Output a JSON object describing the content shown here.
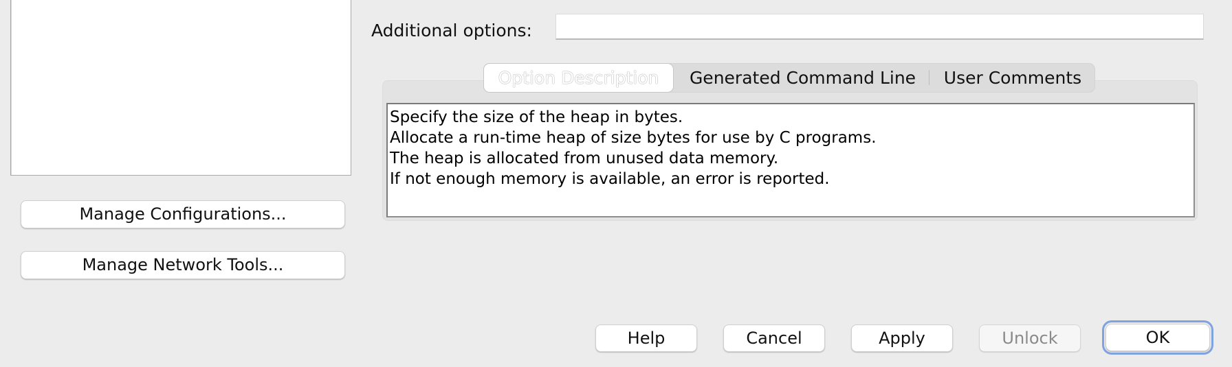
{
  "left_panel": {
    "manage_configurations_label": "Manage Configurations...",
    "manage_network_tools_label": "Manage Network Tools..."
  },
  "additional_options": {
    "label": "Additional options:",
    "value": ""
  },
  "tabs": [
    {
      "label": "Option Description",
      "selected": true
    },
    {
      "label": "Generated Command Line",
      "selected": false
    },
    {
      "label": "User Comments",
      "selected": false
    }
  ],
  "option_description": {
    "lines": [
      "Specify the size of the heap in bytes.",
      "Allocate a run-time heap of size bytes for use by C programs.",
      "The heap is allocated from unused data memory.",
      "If not enough memory is available, an error is reported."
    ]
  },
  "footer_buttons": {
    "help": "Help",
    "cancel": "Cancel",
    "apply": "Apply",
    "unlock": "Unlock",
    "ok": "OK"
  },
  "states": {
    "unlock_enabled": false,
    "ok_is_default": true
  },
  "colors": {
    "background": "#ececec",
    "focus_ring": "#7fa2e0",
    "disabled_text": "#8a8a8a"
  }
}
